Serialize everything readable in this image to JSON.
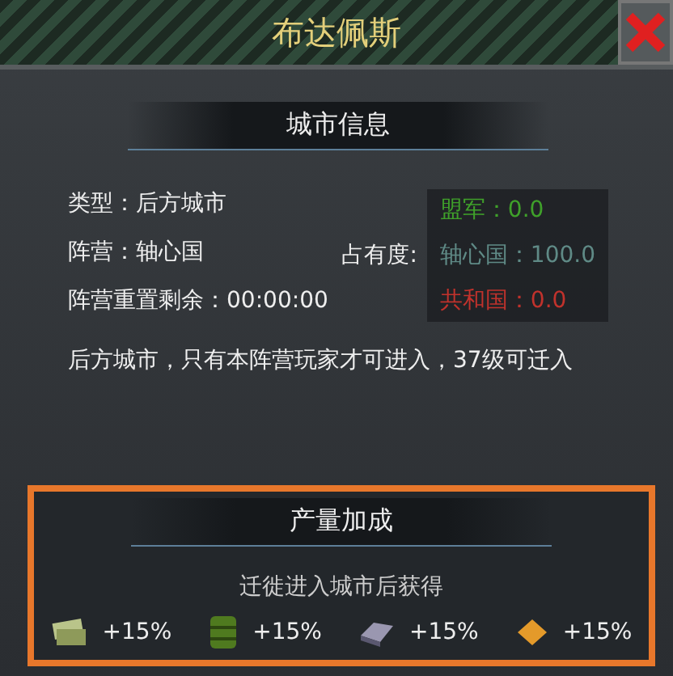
{
  "title": "布达佩斯",
  "info": {
    "heading": "城市信息",
    "rows": [
      "类型：后方城市",
      "阵营：轴心国",
      "阵营重置剩余：00:00:00"
    ],
    "occupancy_label": "占有度:",
    "factions": [
      {
        "text": "盟军：0.0",
        "color": "#3fa02a"
      },
      {
        "text": "轴心国：100.0",
        "color": "#5f8a86"
      },
      {
        "text": "共和国：0.0",
        "color": "#c0322c"
      }
    ],
    "description": "后方城市，只有本阵营玩家才可进入，37级可迁入"
  },
  "bonus": {
    "heading": "产量加成",
    "subtitle": "迁徙进入城市后获得",
    "items": [
      {
        "kind": "money",
        "value": "+15%"
      },
      {
        "kind": "oil",
        "value": "+15%"
      },
      {
        "kind": "steel",
        "value": "+15%"
      },
      {
        "kind": "gold",
        "value": "+15%"
      }
    ]
  }
}
